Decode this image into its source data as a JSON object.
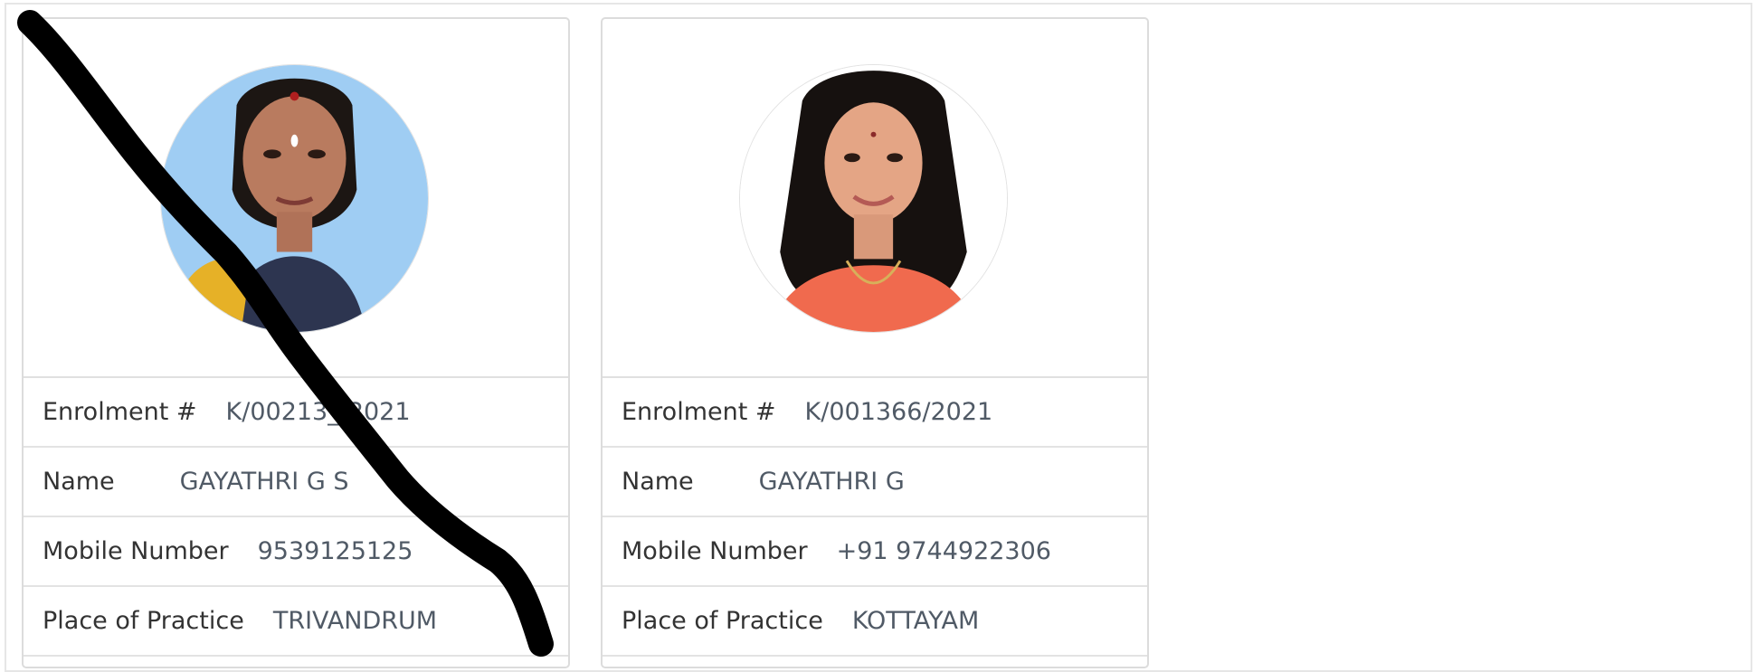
{
  "labels": {
    "enrolment": "Enrolment #",
    "name": "Name",
    "mobile": "Mobile Number",
    "place": "Place of Practice"
  },
  "cards": [
    {
      "enrolment": "K/00213_/2021",
      "name": "GAYATHRI G S",
      "mobile": "9539125125",
      "place": "TRIVANDRUM",
      "photo_background": "#9fcdf3"
    },
    {
      "enrolment": "K/001366/2021",
      "name": "GAYATHRI G",
      "mobile": "+91 9744922306",
      "place": "KOTTAYAM",
      "photo_background": "#ffffff"
    }
  ],
  "colors": {
    "label_text": "#333333",
    "value_text": "#505a66",
    "border": "#dcdcdc",
    "scribble": "#000000"
  }
}
